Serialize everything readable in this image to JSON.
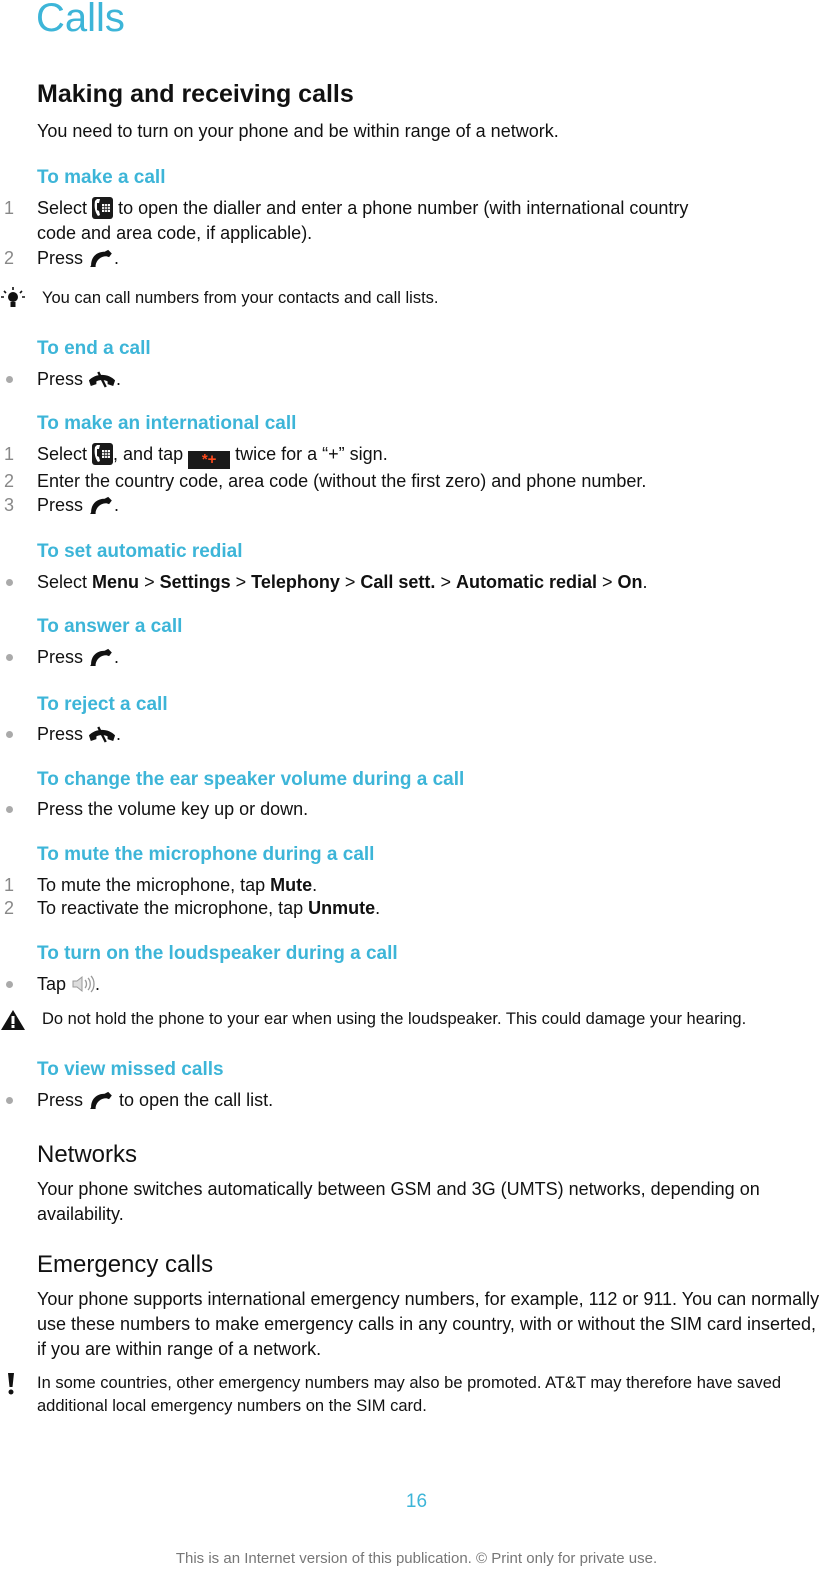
{
  "page": {
    "chapter_title": "Calls",
    "page_number": "16",
    "footer_note": "This is an Internet version of this publication. © Print only for private use.",
    "accent_color": "#3db5d8"
  },
  "making_receiving": {
    "title": "Making and receiving calls",
    "intro": "You need to turn on your phone and be within range of a network."
  },
  "make_call": {
    "heading": "To make a call",
    "step1_num": "1",
    "step1_a": "Select",
    "step1_b": "to open the dialler and enter a phone number (with international country",
    "step1_c": "code and area code, if applicable).",
    "step2_num": "2",
    "step2_a": "Press",
    "step2_b": ".",
    "tip": "You can call numbers from your contacts and call lists."
  },
  "end_call": {
    "heading": "To end a call",
    "step_a": "Press",
    "step_b": "."
  },
  "international_call": {
    "heading": "To make an international call",
    "step1_num": "1",
    "step1_a": "Select",
    "step1_b": ", and tap",
    "step1_key": "*+",
    "step1_c": "twice for a “+” sign.",
    "step2_num": "2",
    "step2": "Enter the country code, area code (without the first zero) and phone number.",
    "step3_num": "3",
    "step3_a": "Press",
    "step3_b": "."
  },
  "auto_redial": {
    "heading": "To set automatic redial",
    "select": "Select",
    "path": [
      "Menu",
      "Settings",
      "Telephony",
      "Call sett.",
      "Automatic redial",
      "On"
    ],
    "sep": ">",
    "end": "."
  },
  "answer_call": {
    "heading": "To answer a call",
    "step_a": "Press",
    "step_b": "."
  },
  "reject_call": {
    "heading": "To reject a call",
    "step_a": "Press",
    "step_b": "."
  },
  "ear_volume": {
    "heading": "To change the ear speaker volume during a call",
    "step": "Press the volume key up or down."
  },
  "mute_mic": {
    "heading": "To mute the microphone during a call",
    "step1_num": "1",
    "step1_a": "To mute the microphone, tap",
    "step1_bold": "Mute",
    "step1_b": ".",
    "step2_num": "2",
    "step2_a": "To reactivate the microphone, tap",
    "step2_bold": "Unmute",
    "step2_b": "."
  },
  "loudspeaker": {
    "heading": "To turn on the loudspeaker during a call",
    "step_a": "Tap",
    "step_b": ".",
    "warning": "Do not hold the phone to your ear when using the loudspeaker. This could damage your hearing."
  },
  "missed_calls": {
    "heading": "To view missed calls",
    "step_a": "Press",
    "step_b": "to open the call list."
  },
  "networks": {
    "title": "Networks",
    "body": "Your phone switches automatically between GSM and 3G (UMTS) networks, depending on availability."
  },
  "emergency": {
    "title": "Emergency calls",
    "body": "Your phone supports international emergency numbers, for example, 112 or 911. You can normally use these numbers to make emergency calls in any country, with or without the SIM card inserted, if you are within range of a network.",
    "note": "In some countries, other emergency numbers may also be promoted. AT&T may therefore have saved additional local emergency numbers on the SIM card."
  }
}
